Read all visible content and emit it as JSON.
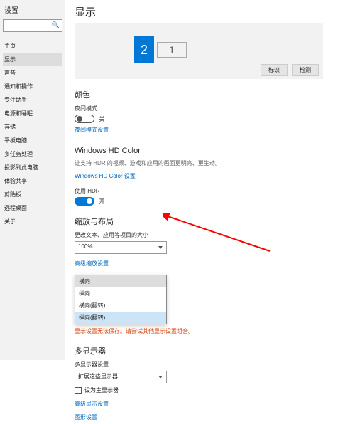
{
  "left": {
    "title": "设置",
    "search_placeholder": "",
    "nav": [
      "主页",
      "显示",
      "声音",
      "通知和操作",
      "专注助手",
      "电源和睡眠",
      "存储",
      "平板电脑",
      "多任务处理",
      "投影到此电脑",
      "体验共享",
      "剪贴板",
      "远程桌面",
      "关于"
    ]
  },
  "header": "显示",
  "displaybox": {
    "mon2": "2",
    "mon1": "1",
    "identify": "标识",
    "detect": "检测"
  },
  "color": {
    "title": "颜色",
    "night_label": "夜间模式",
    "off_text": "关",
    "link": "夜间模式设置"
  },
  "hdr": {
    "title": "Windows HD Color",
    "desc": "让支持 HDR 的视频、游戏和应用的画面更明亮、更生动。",
    "link": "Windows HD Color 设置",
    "use_label": "使用 HDR",
    "on_text": "开"
  },
  "scale": {
    "title": "缩放与布局",
    "text_label": "更改文本、应用等项目的大小",
    "value": "100%",
    "adv_link": "高级缩放设置",
    "orient": {
      "options": [
        "横向",
        "纵向",
        "横向(翻转)",
        "纵向(翻转)"
      ]
    },
    "error": "显示设置无法保存。请尝试其他显示设置组合。"
  },
  "multi": {
    "title": "多显示器",
    "label": "多显示器设置",
    "value": "扩展这些显示器",
    "chk_label": "设为主显示器",
    "adv_link": "高级显示设置",
    "gfx_link": "图形设置"
  }
}
